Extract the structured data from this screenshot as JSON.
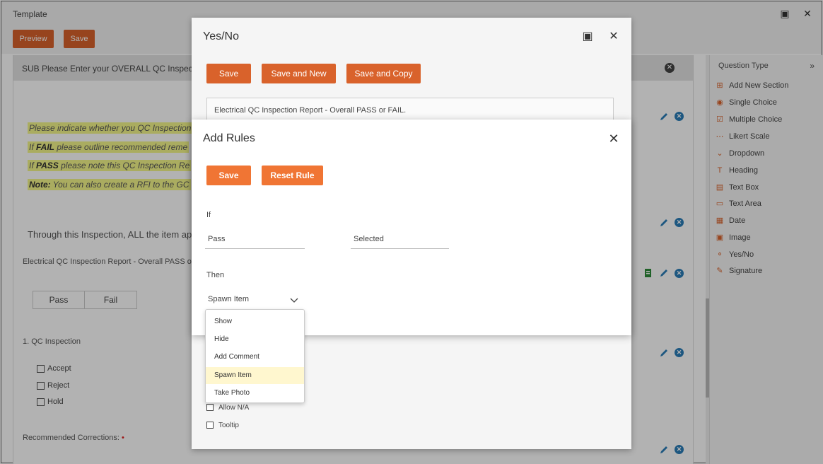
{
  "window": {
    "title": "Template"
  },
  "toolbar": {
    "preview": "Preview",
    "save": "Save"
  },
  "page": {
    "sub_header": "SUB Please Enter your OVERALL QC Inspectio",
    "notes": [
      "Please indicate whether you QC Inspection",
      "If FAIL please outline recommended reme",
      "If PASS please note this QC Inspection Re",
      "Note: You can also create a RFI to the GC"
    ],
    "through_text": "Through this Inspection, ALL the item appe",
    "report_label": "Electrical QC Inspection Report - Overall PASS o",
    "options": [
      "Pass",
      "Fail"
    ],
    "qc_title": "1. QC Inspection",
    "qc_choices": [
      "Accept",
      "Reject",
      "Hold"
    ],
    "recommended": "Recommended Corrections:",
    "required_mark": "•"
  },
  "sidebar": {
    "header": "Question Type",
    "items": [
      {
        "label": "Add New Section",
        "icon": "add-section-icon"
      },
      {
        "label": "Single Choice",
        "icon": "radio-icon"
      },
      {
        "label": "Multiple Choice",
        "icon": "checkbox-icon"
      },
      {
        "label": "Likert Scale",
        "icon": "dots-icon"
      },
      {
        "label": "Dropdown",
        "icon": "chevron-down-icon"
      },
      {
        "label": "Heading",
        "icon": "heading-icon"
      },
      {
        "label": "Text Box",
        "icon": "textbox-icon"
      },
      {
        "label": "Text Area",
        "icon": "textarea-icon"
      },
      {
        "label": "Date",
        "icon": "calendar-icon"
      },
      {
        "label": "Image",
        "icon": "image-icon"
      },
      {
        "label": "Yes/No",
        "icon": "yesno-icon"
      },
      {
        "label": "Signature",
        "icon": "pen-icon"
      }
    ]
  },
  "yesno_dialog": {
    "title": "Yes/No",
    "save": "Save",
    "save_new": "Save and New",
    "save_copy": "Save and Copy",
    "question": "Electrical QC Inspection Report - Overall PASS or FAIL.",
    "allow_na": "Allow N/A",
    "tooltip": "Tooltip"
  },
  "rules_dialog": {
    "title": "Add Rules",
    "save": "Save",
    "reset": "Reset Rule",
    "if_label": "If",
    "if_value": "Pass",
    "if_state": "Selected",
    "then_label": "Then",
    "then_value": "Spawn Item",
    "options": [
      "Show",
      "Hide",
      "Add Comment",
      "Spawn Item",
      "Take Photo"
    ],
    "selected_option": "Spawn Item"
  },
  "colors": {
    "accent": "#d9622b",
    "button": "#f07534",
    "blue_icon": "#2a7db8"
  }
}
